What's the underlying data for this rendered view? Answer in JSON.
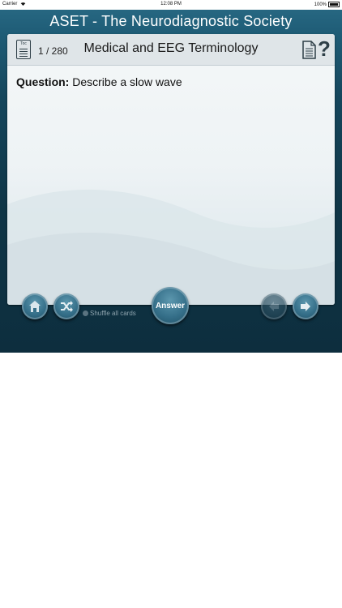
{
  "status_bar": {
    "carrier": "Carrier",
    "time": "12:08 PM",
    "battery": "100%"
  },
  "app_title": "ASET - The Neurodiagnostic Society",
  "card": {
    "toc_label": "Toc",
    "page_count": "1 / 280",
    "title": "Medical and EEG Terminology",
    "question_label": "Question:",
    "question_text": "Describe a slow wave"
  },
  "controls": {
    "shuffle_label": "Shuffle all cards",
    "answer_label": "Answer"
  }
}
